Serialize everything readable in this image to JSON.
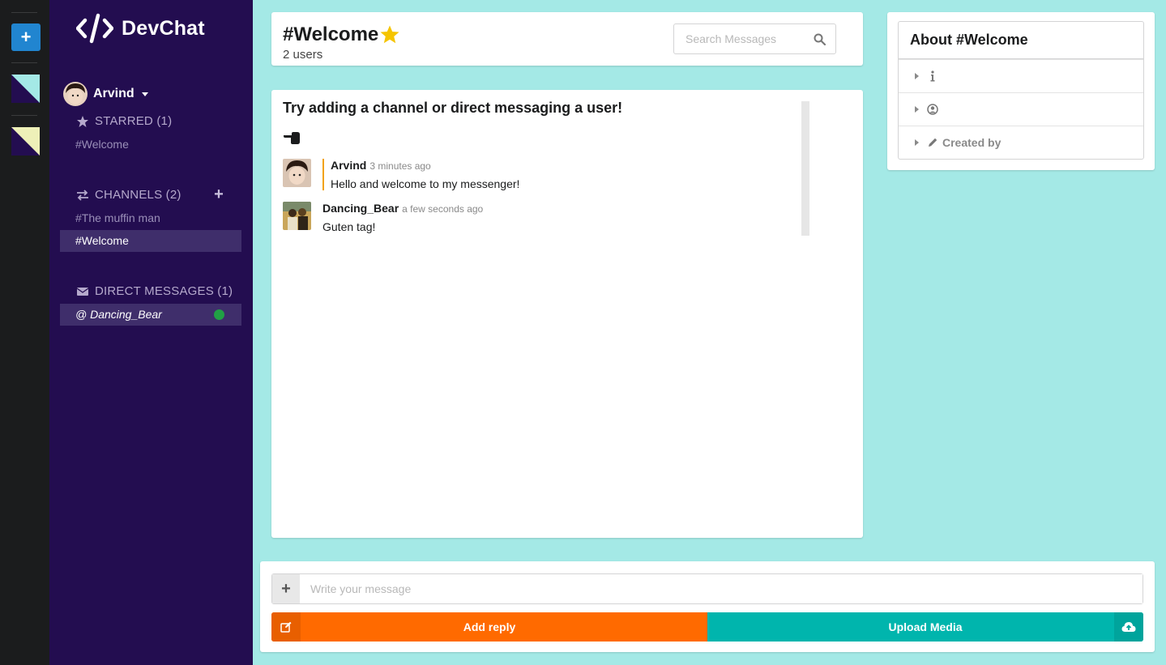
{
  "app": {
    "name": "DevChat"
  },
  "colors": {
    "sidebar": "#230d50",
    "rail": "#1b1c1d",
    "background": "#a4e9e6",
    "reply": "#ff6a00",
    "upload": "#00b5ad",
    "online": "#21a045",
    "star": "#f5c400"
  },
  "rail": {
    "add_label": "+"
  },
  "user": {
    "name": "Arvind"
  },
  "starred": {
    "title": "STARRED (1)",
    "items": [
      "#Welcome"
    ]
  },
  "channels": {
    "title": "CHANNELS (2)",
    "items": [
      "#The muffin man",
      "#Welcome"
    ]
  },
  "direct_messages": {
    "title": "DIRECT MESSAGES (1)",
    "items": [
      "@ Dancing_Bear"
    ]
  },
  "header": {
    "channel": "#Welcome",
    "users": "2 users",
    "search_placeholder": "Search Messages"
  },
  "messages": {
    "intro": "Try adding a channel or direct messaging a user!",
    "items": [
      {
        "author": "Arvind",
        "time": "3 minutes ago",
        "text": "Hello and welcome to my messenger!"
      },
      {
        "author": "Dancing_Bear",
        "time": "a few seconds ago",
        "text": "Guten tag!"
      }
    ]
  },
  "about": {
    "title": "About #Welcome",
    "rows": [
      "",
      "",
      "Created by"
    ]
  },
  "form": {
    "plus_label": "+",
    "placeholder": "Write your message",
    "reply_label": "Add reply",
    "upload_label": "Upload Media"
  }
}
